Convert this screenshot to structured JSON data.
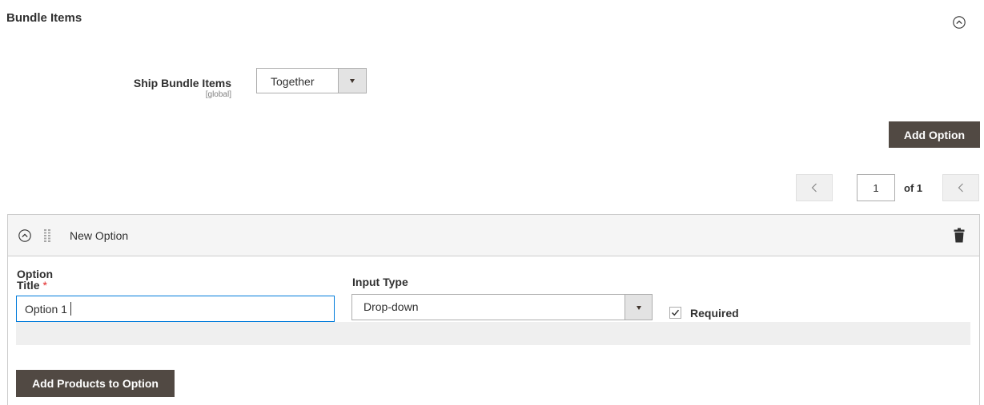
{
  "section": {
    "title": "Bundle Items"
  },
  "ship_bundle": {
    "label": "Ship Bundle Items",
    "scope": "[global]",
    "selected": "Together"
  },
  "toolbar": {
    "add_option_label": "Add Option"
  },
  "pager": {
    "current_page": "1",
    "of_label": "of 1"
  },
  "option": {
    "header_title": "New Option",
    "title_label_line1": "Option",
    "title_label_line2": "Title",
    "required_marker": "*",
    "title_value": "Option 1",
    "input_type_label": "Input Type",
    "input_type_value": "Drop-down",
    "required_label": "Required",
    "required_checked": true,
    "add_products_label": "Add Products to Option"
  },
  "colors": {
    "primary_button": "#514943",
    "focus_border": "#007bdb",
    "required_star": "#e22626"
  },
  "icons": {
    "section_collapse": "chevron-up-circle-icon",
    "option_collapse": "chevron-up-circle-icon",
    "drag_handle": "drag-handle-icon",
    "delete": "trash-icon",
    "pager_prev": "chevron-left-icon",
    "pager_next": "chevron-left-icon",
    "select_arrow": "triangle-down-icon",
    "checkmark": "check-icon"
  }
}
